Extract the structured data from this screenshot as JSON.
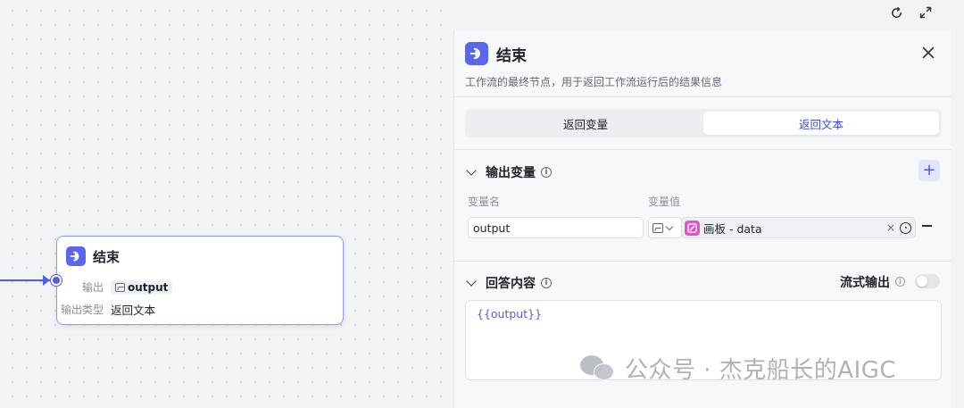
{
  "canvas": {
    "node": {
      "title": "结束",
      "output_label": "输出",
      "output_chip": "output",
      "output_type_label": "输出类型",
      "output_type_value": "返回文本"
    }
  },
  "panel": {
    "title": "结束",
    "description": "工作流的最终节点，用于返回工作流运行后的结果信息",
    "tabs": [
      {
        "label": "返回变量",
        "active": false
      },
      {
        "label": "返回文本",
        "active": true
      }
    ],
    "output_section": {
      "title": "输出变量",
      "col_name": "变量名",
      "col_value": "变量值",
      "variable_name": "output",
      "variable_value": "画板 - data",
      "clear_glyph": "×"
    },
    "answer_section": {
      "title": "回答内容",
      "stream_label": "流式输出",
      "stream_enabled": false,
      "content": "{{output}}"
    }
  },
  "watermark": {
    "text": "公众号 · 杰克船长的AIGC"
  },
  "colors": {
    "accent": "#4e5ee0",
    "node_icon": "#5a67ea",
    "variable_icon": "#e255c7"
  }
}
